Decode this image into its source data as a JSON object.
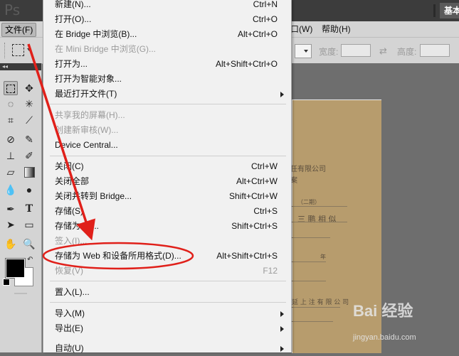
{
  "app": {
    "logo": "Ps",
    "workspace_label": "基本"
  },
  "menubar": {
    "file": "文件(F)",
    "window_partial": "口(W)",
    "help": "帮助(H)"
  },
  "options": {
    "width_label": "宽度:",
    "height_label": "高度:",
    "swap_glyph": "⇄"
  },
  "file_menu": {
    "items": [
      {
        "label": "新建(N)...",
        "shortcut": "Ctrl+N",
        "disabled": false,
        "submenu": false
      },
      {
        "label": "打开(O)...",
        "shortcut": "Ctrl+O",
        "disabled": false,
        "submenu": false
      },
      {
        "label": "在 Bridge 中浏览(B)...",
        "shortcut": "Alt+Ctrl+O",
        "disabled": false,
        "submenu": false
      },
      {
        "label": "在 Mini Bridge 中浏览(G)...",
        "shortcut": "",
        "disabled": true,
        "submenu": false
      },
      {
        "label": "打开为...",
        "shortcut": "Alt+Shift+Ctrl+O",
        "disabled": false,
        "submenu": false
      },
      {
        "label": "打开为智能对象...",
        "shortcut": "",
        "disabled": false,
        "submenu": false
      },
      {
        "label": "最近打开文件(T)",
        "shortcut": "",
        "disabled": false,
        "submenu": true
      },
      {
        "label": "共享我的屏幕(H)...",
        "shortcut": "",
        "disabled": true,
        "submenu": false
      },
      {
        "label": "创建新审核(W)...",
        "shortcut": "",
        "disabled": true,
        "submenu": false
      },
      {
        "label": "Device Central...",
        "shortcut": "",
        "disabled": false,
        "submenu": false
      },
      {
        "label": "关闭(C)",
        "shortcut": "Ctrl+W",
        "disabled": false,
        "submenu": false
      },
      {
        "label": "关闭全部",
        "shortcut": "Alt+Ctrl+W",
        "disabled": false,
        "submenu": false
      },
      {
        "label": "关闭并转到 Bridge...",
        "shortcut": "Shift+Ctrl+W",
        "disabled": false,
        "submenu": false
      },
      {
        "label": "存储(S)",
        "shortcut": "Ctrl+S",
        "disabled": false,
        "submenu": false
      },
      {
        "label": "存储为(A)...",
        "shortcut": "Shift+Ctrl+S",
        "disabled": false,
        "submenu": false
      },
      {
        "label": "签入(I)...",
        "shortcut": "",
        "disabled": true,
        "submenu": false
      },
      {
        "label": "存储为 Web 和设备所用格式(D)...",
        "shortcut": "Alt+Shift+Ctrl+S",
        "disabled": false,
        "submenu": false
      },
      {
        "label": "恢复(V)",
        "shortcut": "F12",
        "disabled": true,
        "submenu": false
      },
      {
        "label": "置入(L)...",
        "shortcut": "",
        "disabled": false,
        "submenu": false
      },
      {
        "label": "导入(M)",
        "shortcut": "",
        "disabled": false,
        "submenu": true
      },
      {
        "label": "导出(E)",
        "shortcut": "",
        "disabled": false,
        "submenu": true
      },
      {
        "label": "自动(U)",
        "shortcut": "",
        "disabled": false,
        "submenu": true
      }
    ]
  },
  "document": {
    "line1": "任有限公司",
    "line2": "案",
    "line3": "（二期）",
    "line4": "三 鹏 相 似",
    "line5": "年",
    "line6": "延 上 注 有 限 公 司"
  },
  "tools": {
    "header": "◂◂"
  },
  "annotation": {
    "color": "#e0201a"
  },
  "watermark": {
    "brand": "Bai 经验",
    "url": "jingyan.baidu.com"
  }
}
